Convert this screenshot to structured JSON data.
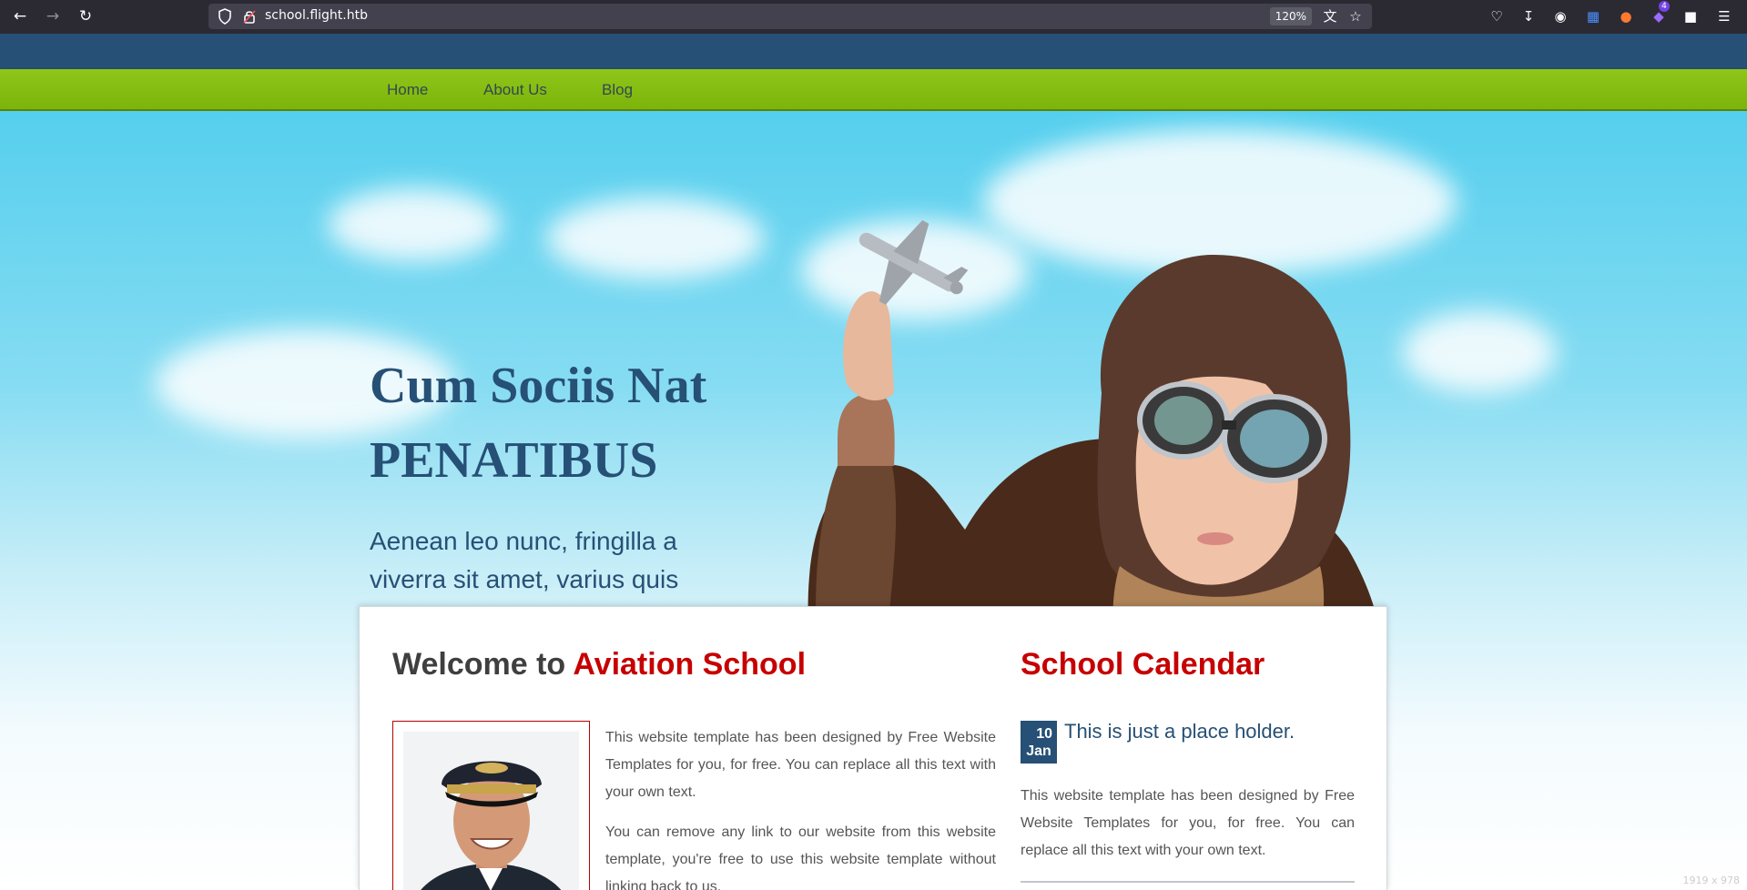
{
  "browser": {
    "url": "school.flight.htb",
    "zoom": "120%",
    "icons": [
      "back-icon",
      "forward-icon",
      "reload-icon",
      "shield-icon",
      "lock-icon",
      "translate-icon",
      "bookmark-star-icon",
      "pocket-icon",
      "download-icon",
      "extension-icon",
      "translator-extension-icon",
      "firefox-extension-icon",
      "extension-badge-icon",
      "extension-icon",
      "menu-icon"
    ],
    "extension_badge": "4"
  },
  "nav": {
    "items": [
      {
        "label": "Home"
      },
      {
        "label": "About Us"
      },
      {
        "label": "Blog"
      }
    ]
  },
  "hero": {
    "title_line1": "Cum Sociis Nat",
    "title_line2": "PENATIBUS",
    "text": "Aenean leo nunc, fringilla a viverra sit amet, varius quis magna. Nunc vel mollis purus."
  },
  "welcome": {
    "prefix": "Welcome to ",
    "accent": "Aviation School",
    "paragraphs": [
      "This website template has been designed by Free Website Templates for you, for free. You can replace all this text with your own text.",
      "You can remove any link to our website from this website template, you're free to use this website template without linking back to us."
    ]
  },
  "calendar": {
    "title": "School Calendar",
    "events": [
      {
        "day": "10",
        "month": "Jan",
        "title": "This is just a place holder.",
        "text": "This website template has been designed by Free Website Templates for you, for free. You can replace all this text with your own text."
      }
    ]
  },
  "colors": {
    "navy": "#265075",
    "green": "#7cb40b",
    "accent_red": "#c60000",
    "sky": "#55cfee"
  },
  "size_label": "1919 x 978"
}
